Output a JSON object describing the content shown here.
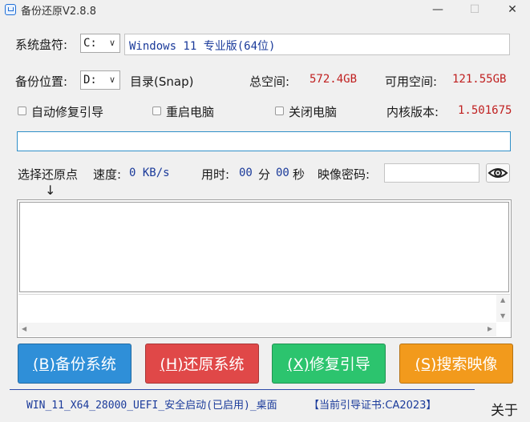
{
  "window": {
    "title": "备份还原V2.8.8",
    "minimize_glyph": "—",
    "maximize_glyph": "☐",
    "close_glyph": "✕"
  },
  "system_drive": {
    "label": "系统盘符:",
    "selected": "C:",
    "os_info": "Windows 11 专业版(64位)"
  },
  "backup_location": {
    "label": "备份位置:",
    "selected": "D:",
    "directory": "目录(Snap)",
    "total_space_label": "总空间:",
    "total_space_value": "572.4GB",
    "free_space_label": "可用空间:",
    "free_space_value": "121.55GB"
  },
  "options": {
    "auto_repair_boot": "自动修复引导",
    "restart_pc": "重启电脑",
    "shutdown_pc": "关闭电脑",
    "kernel_version_label": "内核版本:",
    "kernel_version_value": "1.501675"
  },
  "status": {
    "restore_point_label": "选择还原点",
    "speed_label": "速度:",
    "speed_value": "0 KB/s",
    "elapsed_label": "用时:",
    "elapsed_minutes": "00",
    "minutes_unit": "分",
    "elapsed_seconds": "00",
    "seconds_unit": "秒",
    "image_password_label": "映像密码:",
    "pointer_arrow": "↓"
  },
  "buttons": {
    "backup": {
      "key": "(B)",
      "text": "备份系统",
      "color": "#2f8fd8"
    },
    "restore": {
      "key": "(H)",
      "text": "还原系统",
      "color": "#e04848"
    },
    "repair": {
      "key": "(X)",
      "text": "修复引导",
      "color": "#2cc46e"
    },
    "search": {
      "key": "(S)",
      "text": "搜索映像",
      "color": "#f29a1c"
    }
  },
  "footer": {
    "boot_info": "WIN_11_X64_28000_UEFI_安全启动(已启用)_桌面",
    "certificate": "【当前引导证书:CA2023】",
    "about": "关于"
  }
}
